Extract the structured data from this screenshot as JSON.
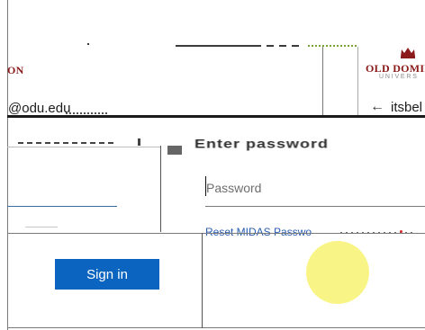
{
  "brand": {
    "left_fragment": "ON",
    "right_name": "OLD DOMIN",
    "right_subtitle": "UNIVERS",
    "accent_color": "#8b1a1a",
    "logo_icon": "crown-icon"
  },
  "identity": {
    "email": "@odu.edu",
    "back_icon": "←",
    "back_user": "itsbel"
  },
  "heading": {
    "text": "Enter password"
  },
  "form": {
    "password_placeholder": "Password",
    "reset_link": "Reset MIDAS Passwo",
    "signin_label": "Sign in"
  },
  "colors": {
    "primary_button": "#0b64c0",
    "link": "#2a5db0",
    "highlight": "#f9f37c"
  }
}
